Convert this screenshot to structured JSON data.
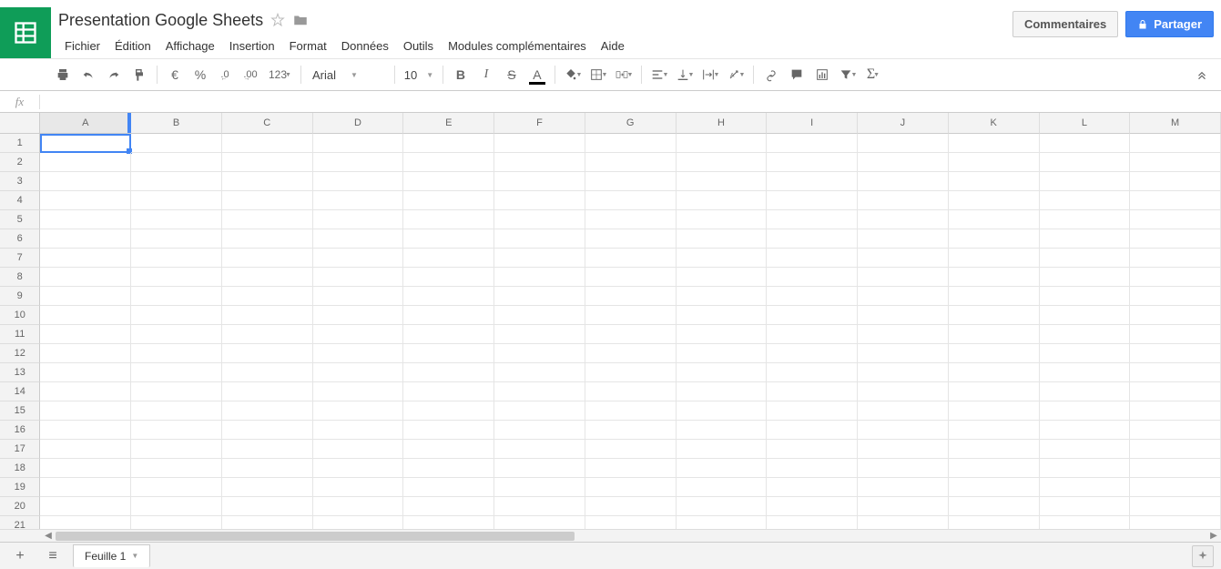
{
  "doc": {
    "title": "Presentation Google Sheets"
  },
  "menu": [
    "Fichier",
    "Édition",
    "Affichage",
    "Insertion",
    "Format",
    "Données",
    "Outils",
    "Modules complémentaires",
    "Aide"
  ],
  "header_buttons": {
    "comments": "Commentaires",
    "share": "Partager"
  },
  "toolbar": {
    "currency": "€",
    "percent": "%",
    "dec_dec": ".0",
    "dec_inc": ".00",
    "format_more": "123",
    "font": "Arial",
    "font_size": "10",
    "bold": "B",
    "italic": "I",
    "strike": "S",
    "text_color": "A"
  },
  "formula": {
    "fx": "fx",
    "value": ""
  },
  "columns": [
    "A",
    "B",
    "C",
    "D",
    "E",
    "F",
    "G",
    "H",
    "I",
    "J",
    "K",
    "L",
    "M"
  ],
  "rows": [
    1,
    2,
    3,
    4,
    5,
    6,
    7,
    8,
    9,
    10,
    11,
    12,
    13,
    14,
    15,
    16,
    17,
    18,
    19,
    20,
    21
  ],
  "active_cell": {
    "row": 1,
    "col": "A"
  },
  "sheet": {
    "tab1": "Feuille 1"
  }
}
